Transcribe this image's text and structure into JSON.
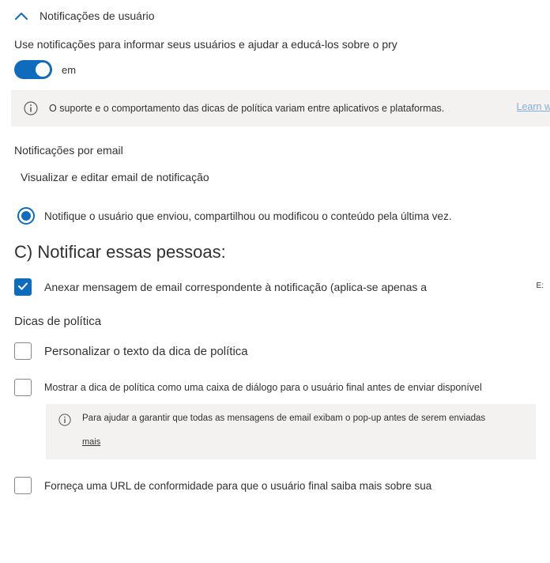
{
  "header": {
    "title": "Notificações de usuário"
  },
  "intro": "Use notificações para informar seus usuários e ajudar a educá-los sobre o pry",
  "toggle": {
    "label": "em",
    "on": true
  },
  "infoBar": {
    "text": "O suporte e o comportamento das dicas de política variam entre aplicativos e plataformas.",
    "learn": "Learn w"
  },
  "email": {
    "subhead": "Notificações por email",
    "link": "Visualizar e editar email de notificação",
    "radioLabel": "Notifique o usuário que enviou, compartilhou ou modificou o conteúdo pela última vez."
  },
  "notify": {
    "heading": "C) Notificar essas pessoas:",
    "attachLabel": "Anexar mensagem de email correspondente à notificação (aplica-se apenas a",
    "tinyE": "E:"
  },
  "tips": {
    "subhead": "Dicas de política",
    "customize": "Personalizar o texto da dica de política",
    "dialog": "Mostrar a dica de política como uma caixa de diálogo para o usuário final antes de enviar disponível",
    "nestedInfo": "Para ajudar a garantir que todas as mensagens de email exibam o pop-up antes de serem enviadas",
    "mais": "mais",
    "url": "Forneça uma URL de conformidade para que o usuário final saiba mais sobre sua"
  }
}
